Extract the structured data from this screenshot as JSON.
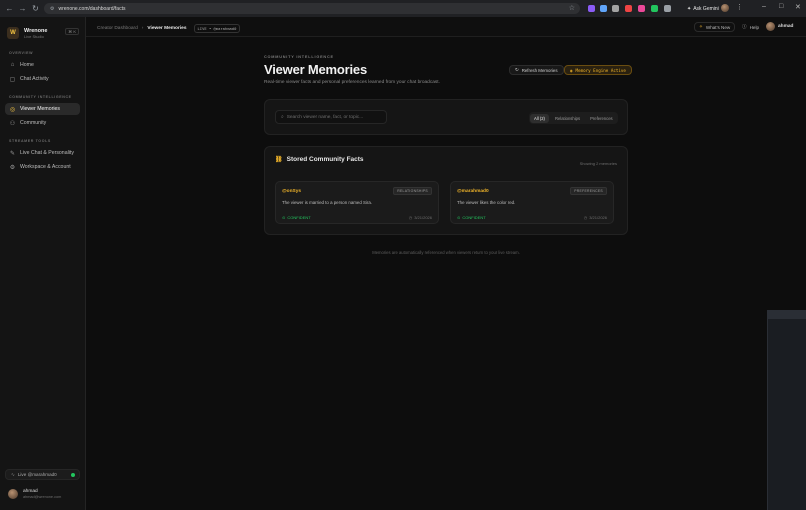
{
  "browser": {
    "url": "wrenone.com/dashboard/facts",
    "ask_gemini": "Ask Gemini",
    "ext_colors": [
      "#8b5cf6",
      "#60a5fa",
      "#a3a3a3",
      "#ef4444",
      "#ec4899",
      "#22c55e",
      "#9aa0a6"
    ]
  },
  "sidebar": {
    "brand_name": "Wrenone",
    "brand_sub": "Live Studio",
    "brand_initial": "W",
    "shortcut": "⌘ K",
    "sections": [
      {
        "label": "OVERVIEW",
        "items": [
          {
            "label": "Home",
            "icon": "home-icon",
            "glyph": "⌂",
            "active": false
          },
          {
            "label": "Chat Activity",
            "icon": "chat-icon",
            "glyph": "▢",
            "active": false
          }
        ]
      },
      {
        "label": "COMMUNITY INTELLIGENCE",
        "items": [
          {
            "label": "Viewer Memories",
            "icon": "lightbulb-icon",
            "glyph": "◎",
            "active": true
          },
          {
            "label": "Community",
            "icon": "users-icon",
            "glyph": "⚇",
            "active": false
          }
        ]
      },
      {
        "label": "STREAMER TOOLS",
        "items": [
          {
            "label": "Live Chat & Personality",
            "icon": "wand-icon",
            "glyph": "✎",
            "active": false
          },
          {
            "label": "Workspace & Account",
            "icon": "gear-icon",
            "glyph": "⚙",
            "active": false
          }
        ]
      }
    ],
    "status": "Live @marahmad0",
    "user": {
      "name": "ahmad",
      "email": "ahmad@wrenone.com"
    }
  },
  "header": {
    "crumb_root": "Creator Dashboard",
    "crumb_current": "Viewer Memories",
    "live_badge": "LIVE • @marahmad0",
    "whats_new": "What's New",
    "help": "Help",
    "user": "ahmad"
  },
  "page": {
    "eyebrow": "COMMUNITY INTELLIGENCE",
    "title": "Viewer Memories",
    "subtitle": "Real-time viewer facts and personal preferences learned from your chat broadcast.",
    "refresh_label": "Refresh Memories",
    "engine_label": "Memory Engine Active",
    "search_placeholder": "Search viewer name, fact, or topic...",
    "filters": [
      {
        "label": "All (2)",
        "active": true
      },
      {
        "label": "Relationships",
        "active": false
      },
      {
        "label": "Preferences",
        "active": false
      }
    ],
    "facts_title": "Stored Community Facts",
    "facts_count": "Showing 2 memories",
    "facts": [
      {
        "user": "@onSys",
        "tag": "RELATIONSHIPS",
        "text": "The viewer is married to a person named Sira.",
        "confidence": "CONFIDENT",
        "date": "3/21/2026"
      },
      {
        "user": "@marahmad0",
        "tag": "PREFERENCES",
        "text": "The viewer likes the color red.",
        "confidence": "CONFIDENT",
        "date": "3/21/2026"
      }
    ],
    "footnote": "Memories are automatically referenced when viewers return to your live stream."
  },
  "colors": {
    "accent": "#f0b429",
    "success": "#22c55e",
    "background": "#0d0d0d"
  }
}
